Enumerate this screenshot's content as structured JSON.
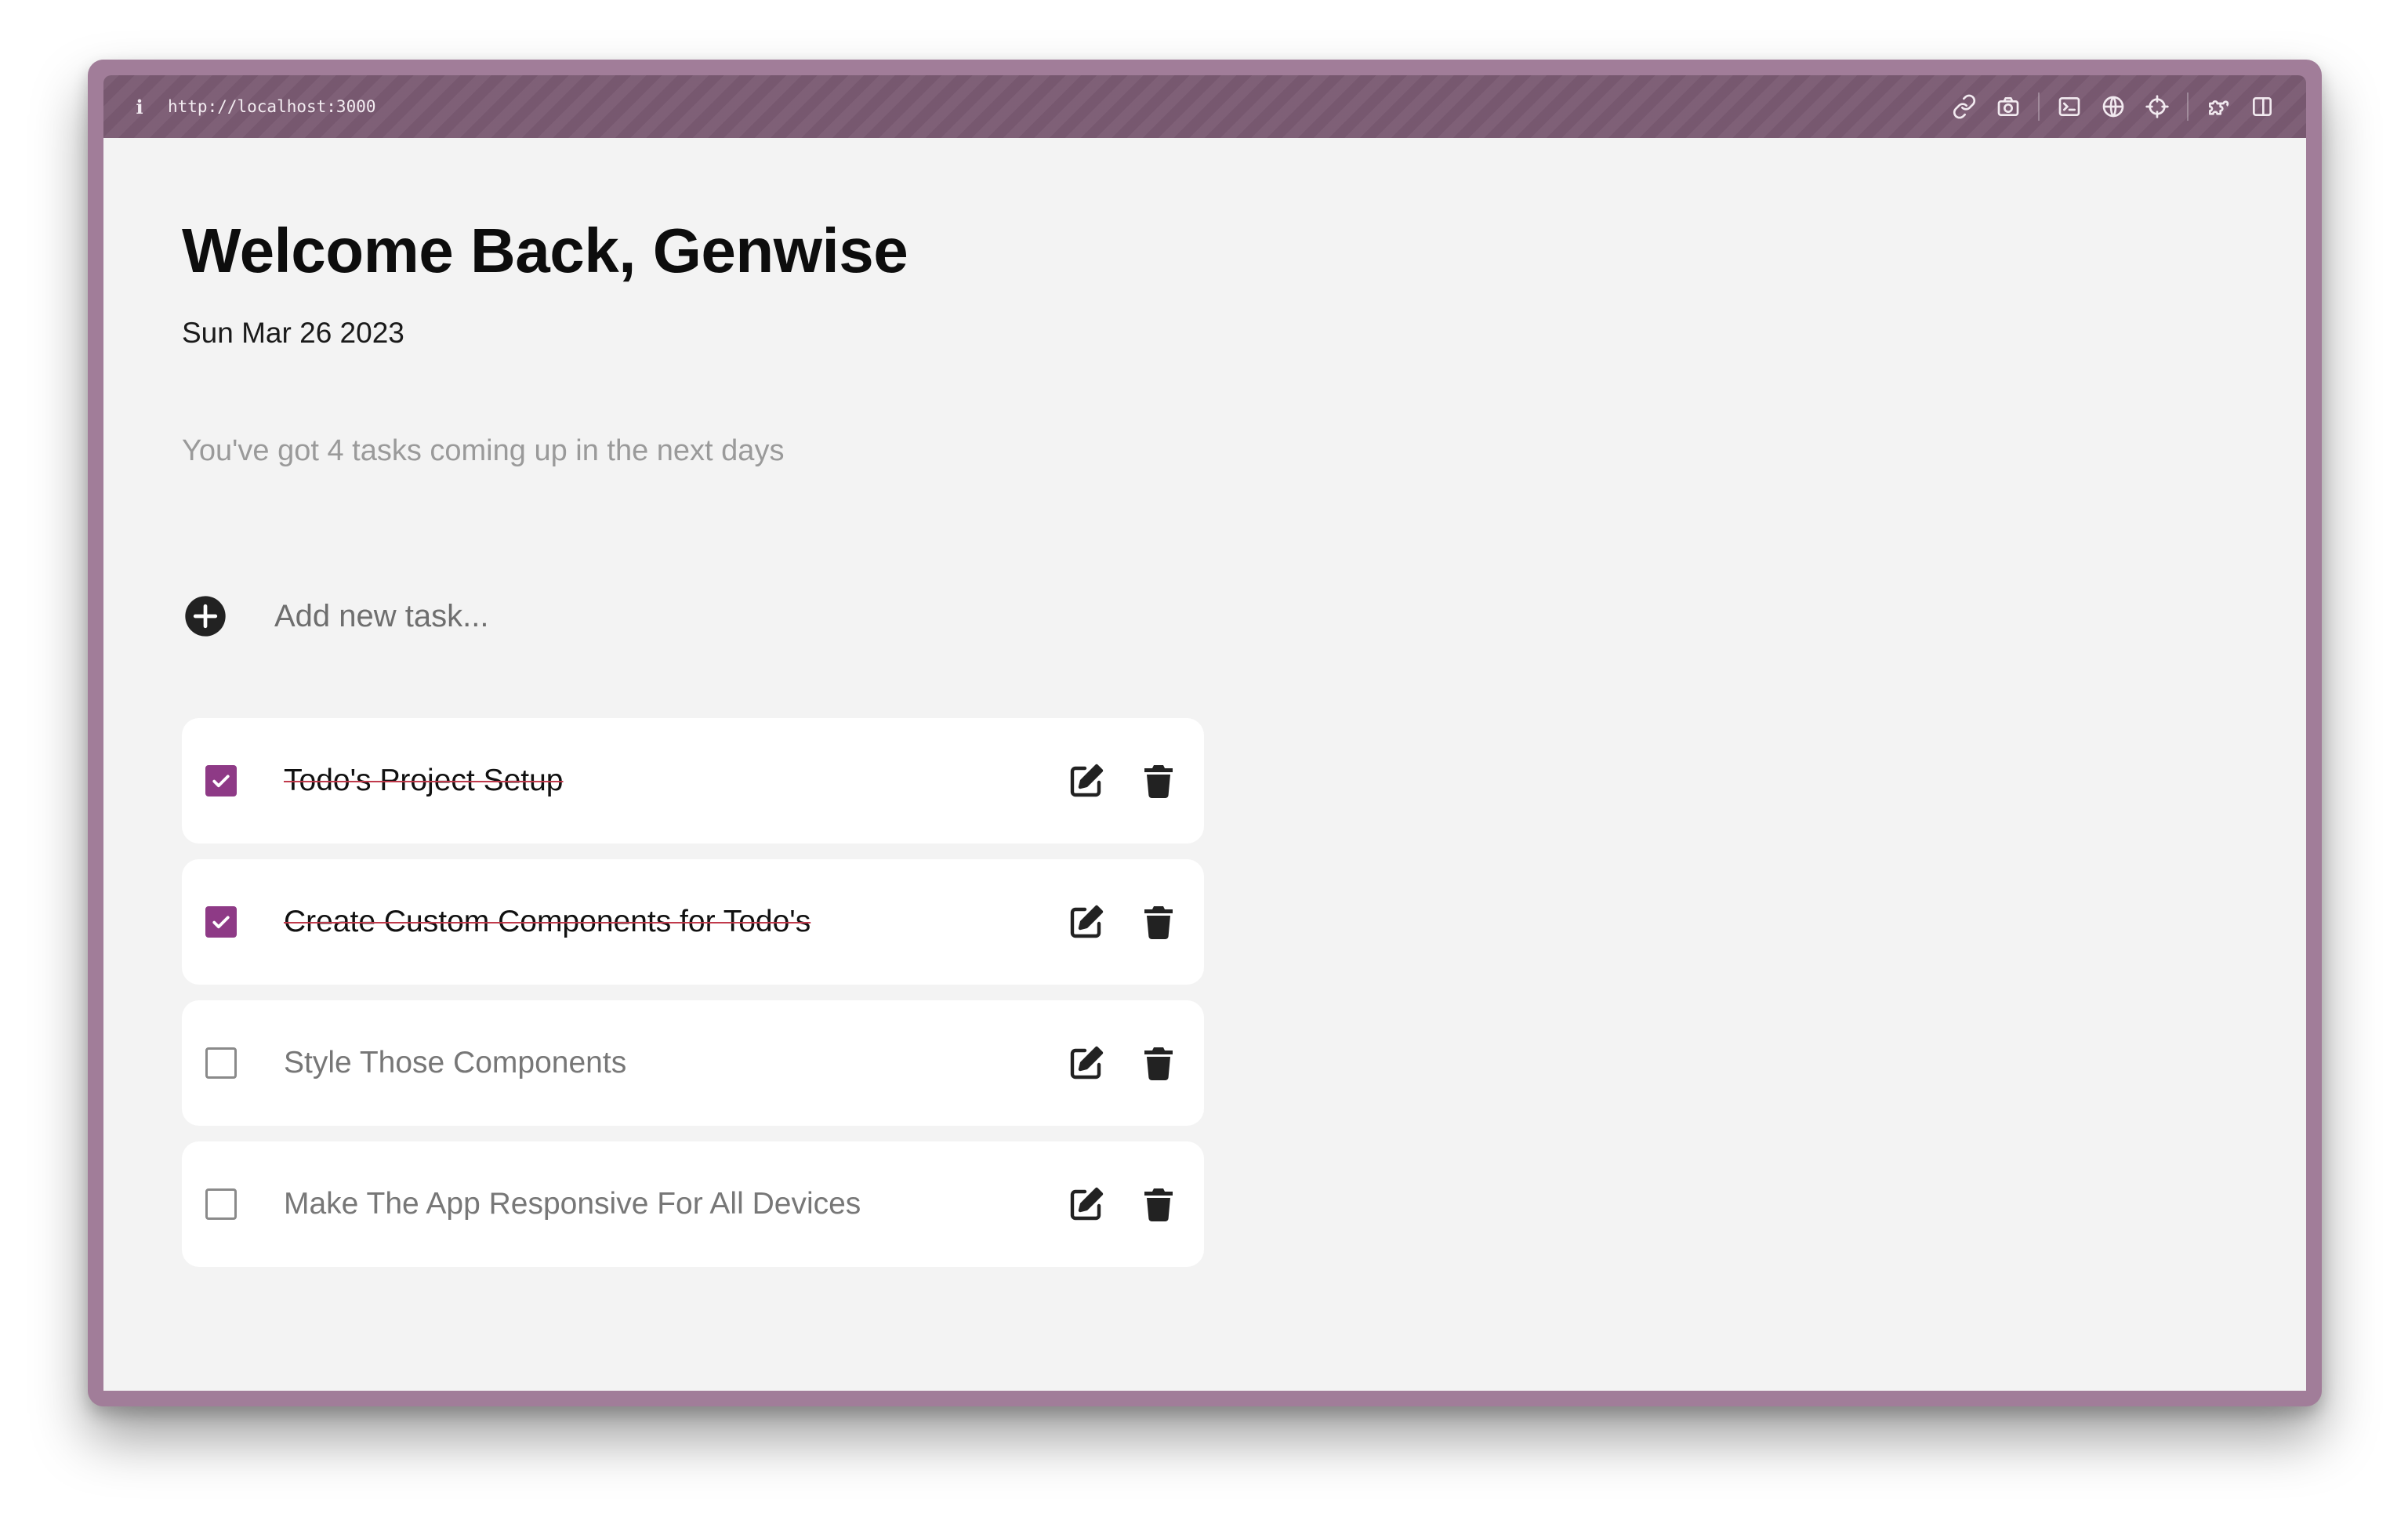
{
  "browser": {
    "info_glyph": "i",
    "url": "http://localhost:3000",
    "tools": [
      "link-icon",
      "camera-icon",
      "terminal-icon",
      "globe-icon",
      "crosshair-icon",
      "extension-icon",
      "split-view-icon"
    ]
  },
  "page": {
    "title": "Welcome Back, Genwise",
    "date": "Sun Mar 26 2023",
    "subtitle": "You've got 4 tasks coming up in the next days"
  },
  "add_task": {
    "placeholder": "Add new task..."
  },
  "tasks": [
    {
      "label": "Todo's Project Setup",
      "done": true
    },
    {
      "label": "Create Custom Components for Todo's",
      "done": true
    },
    {
      "label": "Style Those Components",
      "done": false
    },
    {
      "label": "Make The App Responsive For All Devices",
      "done": false
    }
  ],
  "colors": {
    "window_frame": "#a17d99",
    "toolbar": "#7a5a72",
    "background": "#f3f3f3",
    "checkbox_accent": "#8e3a86",
    "strikethrough": "#c0394b"
  }
}
